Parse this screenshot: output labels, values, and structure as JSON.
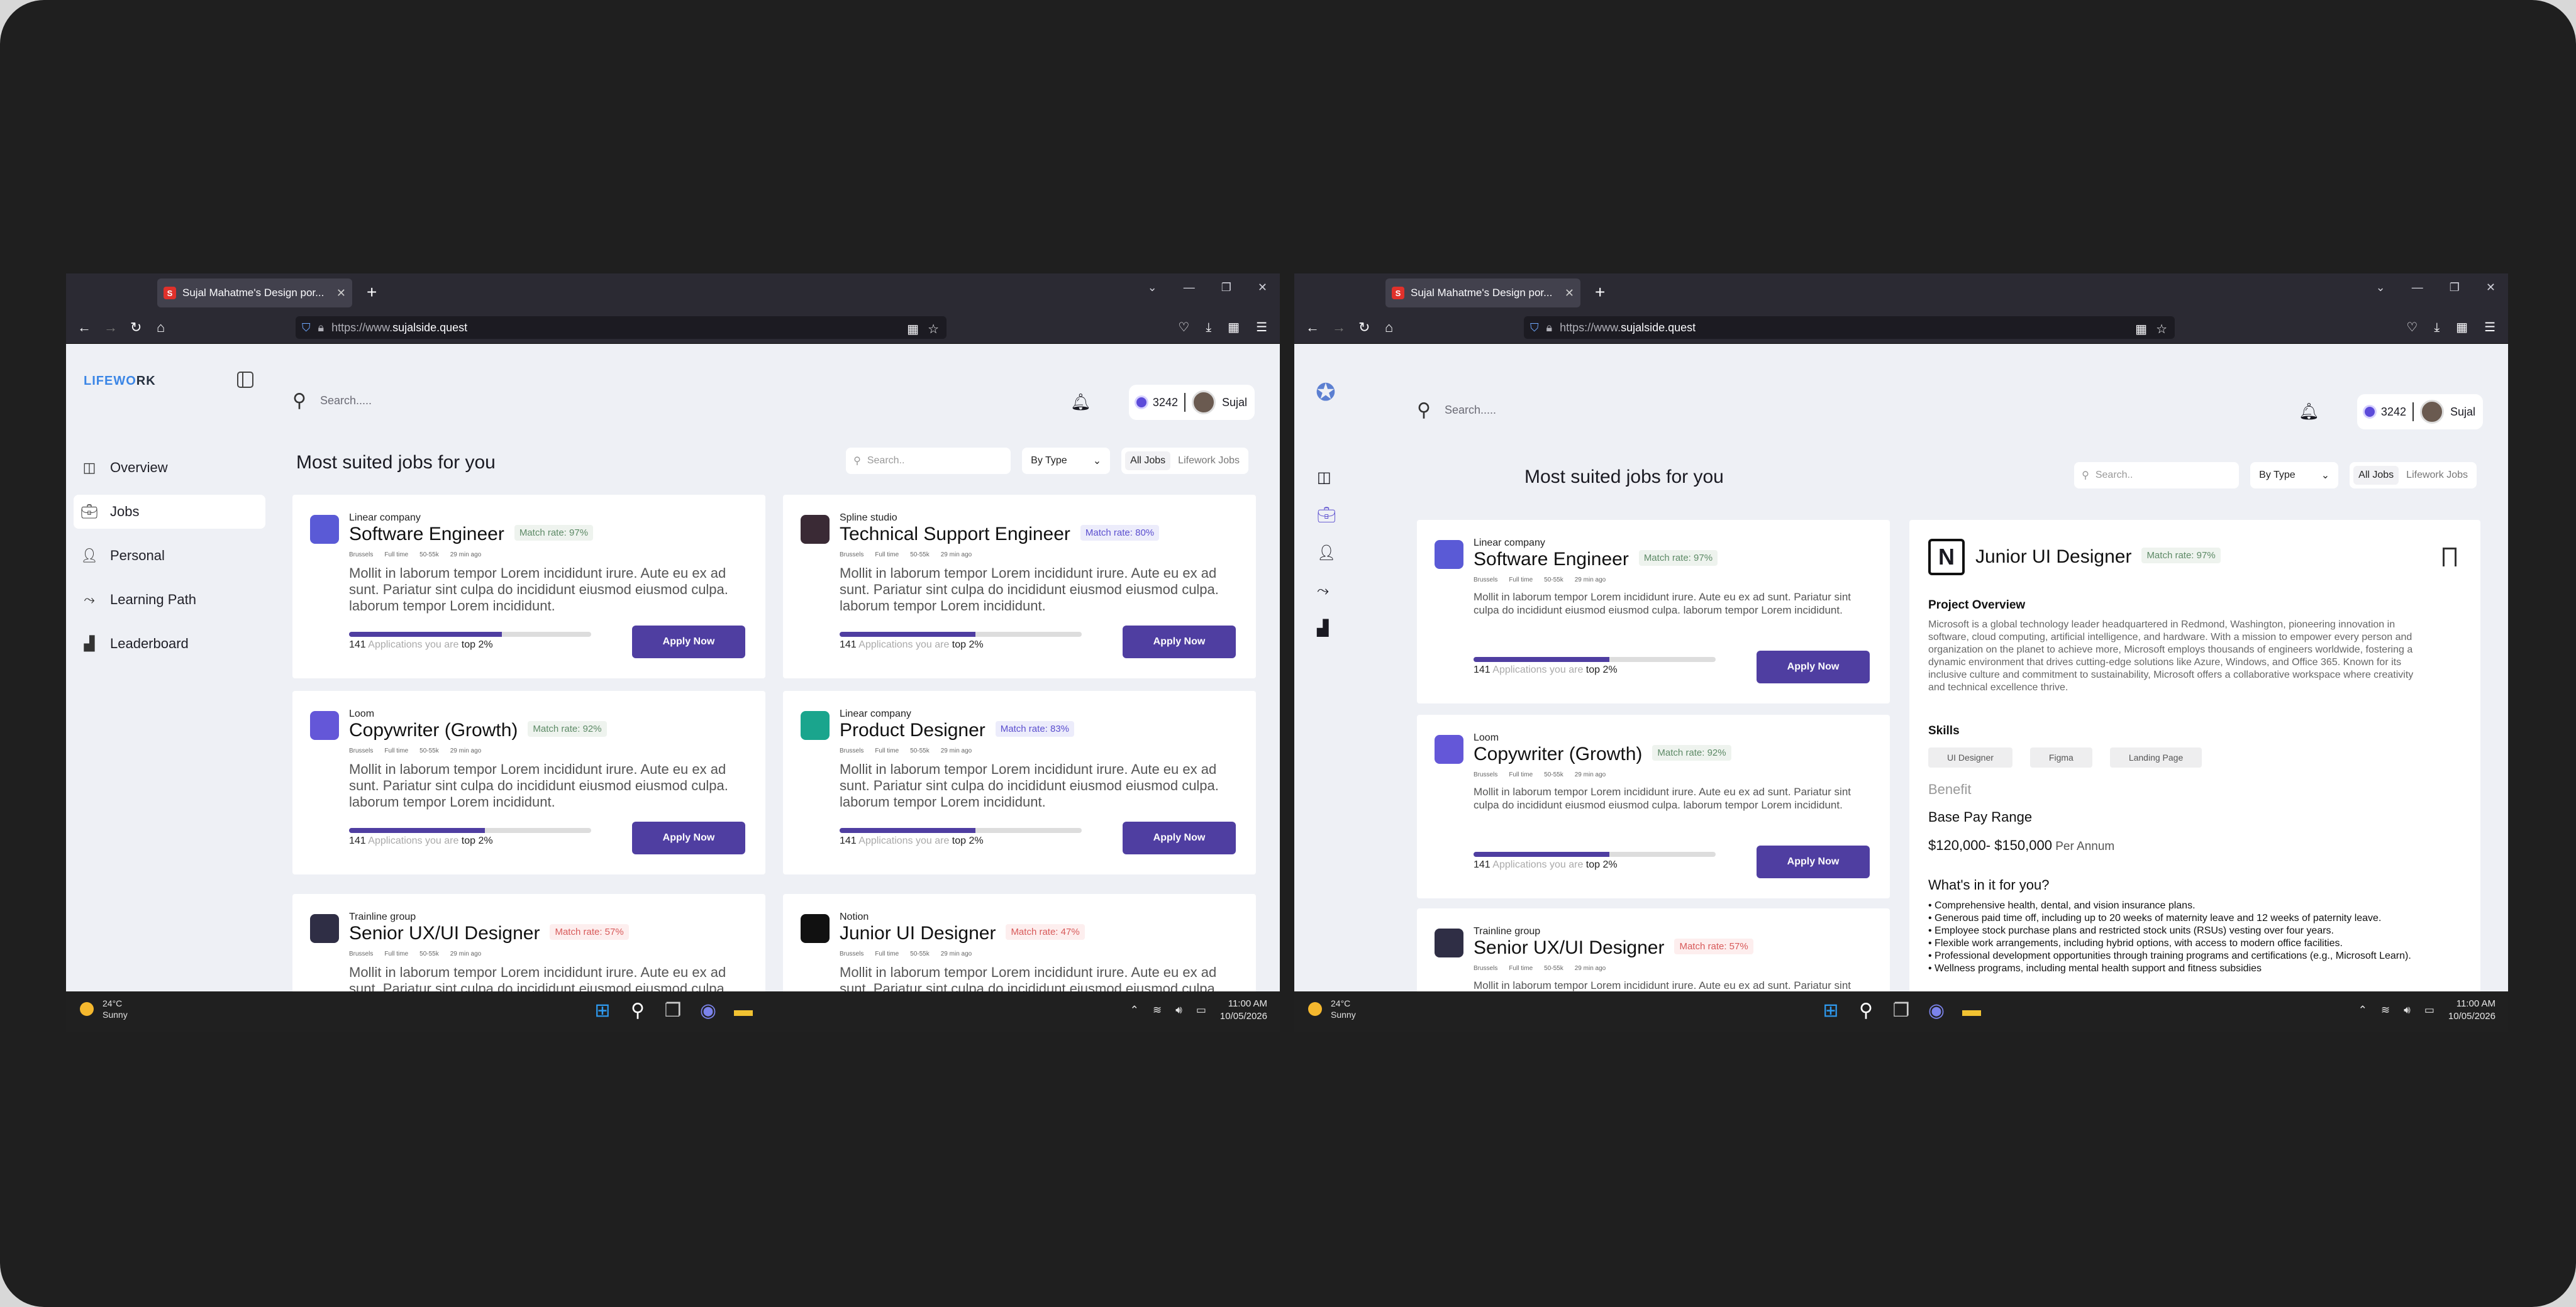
{
  "browser": {
    "tab_title": "Sujal Mahatme's Design por...",
    "tab_close": "✕",
    "new_tab": "+",
    "url_prefix": "https://www.",
    "url_domain": "sujalside.quest"
  },
  "app": {
    "logo_a": "LIFEW",
    "logo_b": "O",
    "logo_c": "RK",
    "nav": [
      {
        "label": "Overview",
        "icon": "overview-icon"
      },
      {
        "label": "Jobs",
        "icon": "briefcase-icon"
      },
      {
        "label": "Personal",
        "icon": "user-icon"
      },
      {
        "label": "Learning Path",
        "icon": "path-icon"
      },
      {
        "label": "Leaderboard",
        "icon": "leaderboard-icon"
      }
    ],
    "search_placeholder": "Search.....",
    "points": "3242",
    "user": "Sujal",
    "heading": "Most suited jobs for you",
    "filter_search": "Search..",
    "filter_type": "By Type",
    "tab_all": "All Jobs",
    "tab_lifework": "Lifework Jobs",
    "apply_label": "Apply Now",
    "desc": "Mollit in laborum tempor Lorem incididunt irure. Aute eu ex ad sunt. Pariatur sint culpa do incididunt eiusmod eiusmod culpa. laborum tempor Lorem incididunt.",
    "meta": {
      "loc": "Brussels",
      "type": "Full time",
      "pay": "50-55k",
      "time": "29 min ago"
    },
    "stat_count": "141",
    "stat_mid": " Applications you are ",
    "stat_top": "top 2%"
  },
  "jobs_left": [
    {
      "company": "Linear company",
      "role": "Software Engineer",
      "match": "Match rate: 97%",
      "logo_color": "#5a5ad6",
      "match_bg": "#eef3ee",
      "match_fg": "#5d8a66",
      "progress": 0.63
    },
    {
      "company": "Spline studio",
      "role": "Technical Support Engineer",
      "match": "Match rate: 80%",
      "logo_color": "#3a2a35",
      "match_bg": "#ececfb",
      "match_fg": "#5b4fcf",
      "progress": 0.56
    },
    {
      "company": "Loom",
      "role": "Copywriter (Growth)",
      "match": "Match rate: 92%",
      "logo_color": "#6457d8",
      "match_bg": "#eef3ee",
      "match_fg": "#5d8a66",
      "progress": 0.56
    },
    {
      "company": "Linear company",
      "role": "Product Designer",
      "match": "Match rate: 83%",
      "logo_color": "#1aa58d",
      "match_bg": "#ececfb",
      "match_fg": "#5b4fcf",
      "progress": 0.56
    },
    {
      "company": "Trainline group",
      "role": "Senior UX/UI Designer",
      "match": "Match rate: 57%",
      "logo_color": "#2f2e45",
      "match_bg": "#fdeeee",
      "match_fg": "#d85a5a",
      "progress": 0.5
    },
    {
      "company": "Notion",
      "role": "Junior UI Designer",
      "match": "Match rate: 47%",
      "logo_color": "#111",
      "match_bg": "#fdeeee",
      "match_fg": "#d85a5a",
      "progress": 0.5
    }
  ],
  "jobs_right": [
    {
      "company": "Linear company",
      "role": "Software Engineer",
      "match": "Match rate: 97%",
      "logo_color": "#5a5ad6",
      "match_bg": "#eef3ee",
      "match_fg": "#5d8a66",
      "progress": 0.56
    },
    {
      "company": "Loom",
      "role": "Copywriter (Growth)",
      "match": "Match rate: 92%",
      "logo_color": "#6457d8",
      "match_bg": "#eef3ee",
      "match_fg": "#5d8a66",
      "progress": 0.56
    },
    {
      "company": "Trainline group",
      "role": "Senior UX/UI Designer",
      "match": "Match rate: 57%",
      "logo_color": "#2f2e45",
      "match_bg": "#fdeeee",
      "match_fg": "#d85a5a",
      "progress": 0.5
    }
  ],
  "right_desc": "Mollit in laborum tempor Lorem incididunt irure. Aute eu ex ad sunt. Pariatur sint culpa do incididunt eiusmod eiusmod culpa. laborum tempor Lorem incididunt.",
  "detail": {
    "title": "Junior UI Designer",
    "match": "Match rate: 97%",
    "overview_heading": "Project Overview",
    "overview": "Microsoft is a global technology leader headquartered in Redmond, Washington, pioneering innovation in software, cloud computing, artificial intelligence, and hardware. With a mission to empower every person and organization on the planet to achieve more, Microsoft employs thousands of engineers worldwide, fostering a dynamic environment that drives cutting-edge solutions like Azure, Windows, and Office 365. Known for its inclusive culture and commitment to sustainability, Microsoft offers a collaborative workspace where creativity and technical excellence thrive.",
    "skills_heading": "Skills",
    "skills": [
      "UI Designer",
      "Figma",
      "Landing Page"
    ],
    "benefit": "Benefit",
    "base_pay": "Base Pay Range",
    "salary": "$120,000- $150,000",
    "per": " Per Annum",
    "whats_in": "What's in it for you?",
    "benefits": [
      "Comprehensive health, dental, and vision insurance plans.",
      "Generous paid time off, including up to 20 weeks of maternity leave and 12 weeks of paternity leave.",
      "Employee stock purchase plans and restricted stock units (RSUs) vesting over four years.",
      "Flexible work arrangements, including hybrid options, with access to modern office facilities.",
      "Professional development opportunities through training programs and certifications (e.g., Microsoft Learn).",
      "Wellness programs, including mental health support and fitness subsidies"
    ]
  },
  "taskbar": {
    "temp": "24°C",
    "weather": "Sunny",
    "time": "11:00 AM",
    "date": "10/05/2026"
  }
}
